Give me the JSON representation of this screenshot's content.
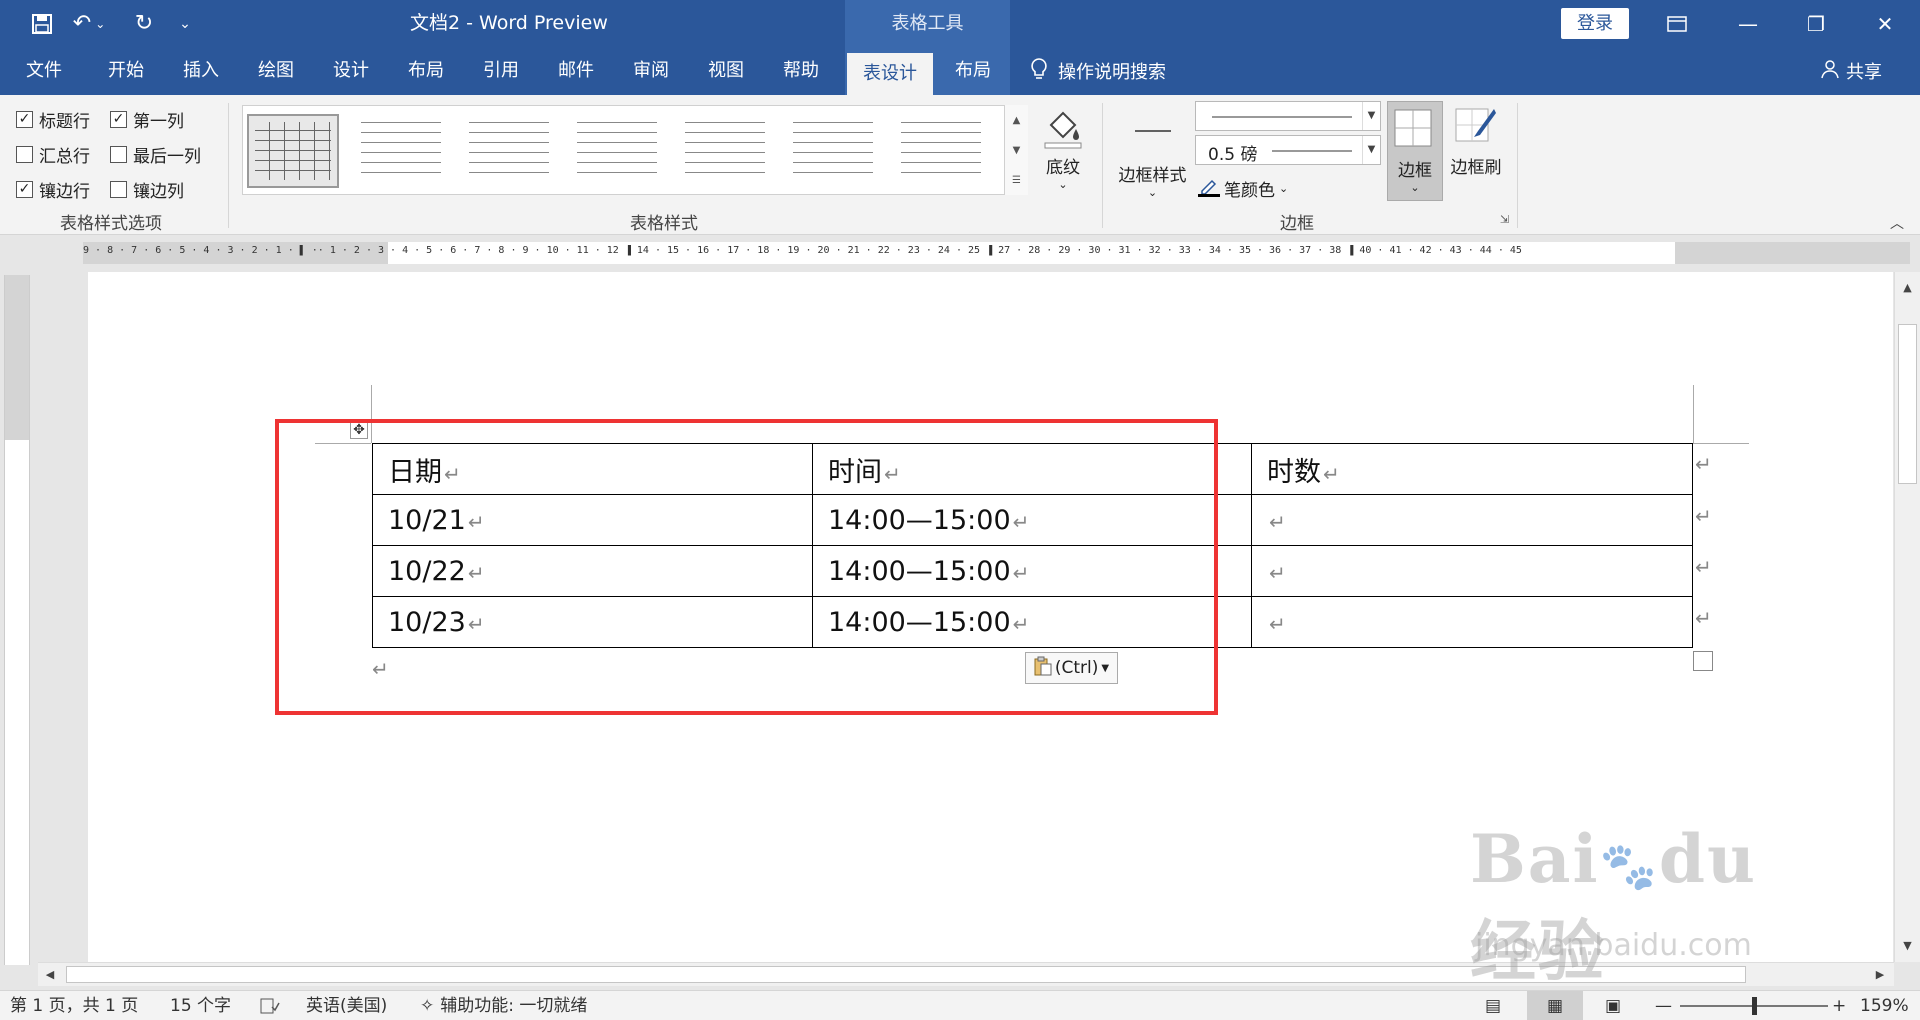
{
  "window": {
    "doc_title": "文档2  -  Word Preview",
    "contextual_tools": "表格工具",
    "login": "登录"
  },
  "quick_access": {
    "save_icon": "save-icon",
    "undo_icon": "undo-icon",
    "redo_icon": "redo-icon",
    "customize_icon": "chevron-down-icon"
  },
  "tabs": [
    {
      "label": "文件"
    },
    {
      "label": "开始"
    },
    {
      "label": "插入"
    },
    {
      "label": "绘图"
    },
    {
      "label": "设计"
    },
    {
      "label": "布局"
    },
    {
      "label": "引用"
    },
    {
      "label": "邮件"
    },
    {
      "label": "审阅"
    },
    {
      "label": "视图"
    },
    {
      "label": "帮助"
    },
    {
      "label": "表设计"
    },
    {
      "label": "布局"
    }
  ],
  "search": {
    "label": "操作说明搜索"
  },
  "share": {
    "label": "共享"
  },
  "ribbon": {
    "style_options": {
      "group_label": "表格样式选项",
      "checkboxes": [
        {
          "label": "标题行",
          "checked": true
        },
        {
          "label": "第一列",
          "checked": true
        },
        {
          "label": "汇总行",
          "checked": false
        },
        {
          "label": "最后一列",
          "checked": false
        },
        {
          "label": "镶边行",
          "checked": true
        },
        {
          "label": "镶边列",
          "checked": false
        }
      ]
    },
    "table_styles": {
      "group_label": "表格样式"
    },
    "shading": {
      "label": "底纹"
    },
    "borders": {
      "group_label": "边框",
      "border_styles": "边框样式",
      "weight": "0.5 磅",
      "pen_color": "笔颜色",
      "borders_btn": "边框",
      "border_painter": "边框刷"
    }
  },
  "table": {
    "rows": [
      [
        "日期",
        "时间",
        "时数"
      ],
      [
        "10/21",
        "14:00—15:00",
        ""
      ],
      [
        "10/22",
        "14:00—15:00",
        ""
      ],
      [
        "10/23",
        "14:00—15:00",
        ""
      ]
    ],
    "paragraph_mark": "↵"
  },
  "paste_options": {
    "label": "(Ctrl)"
  },
  "status": {
    "page": "第 1 页，共 1 页",
    "words": "15 个字",
    "language": "英语(美国)",
    "accessibility": "辅助功能: 一切就绪",
    "zoom": "159%"
  },
  "watermark": {
    "logo": "Bai du 经验",
    "sub": "jingyan.baidu.com"
  },
  "colors": {
    "brand": "#2b579a",
    "highlight": "#ee3333"
  }
}
